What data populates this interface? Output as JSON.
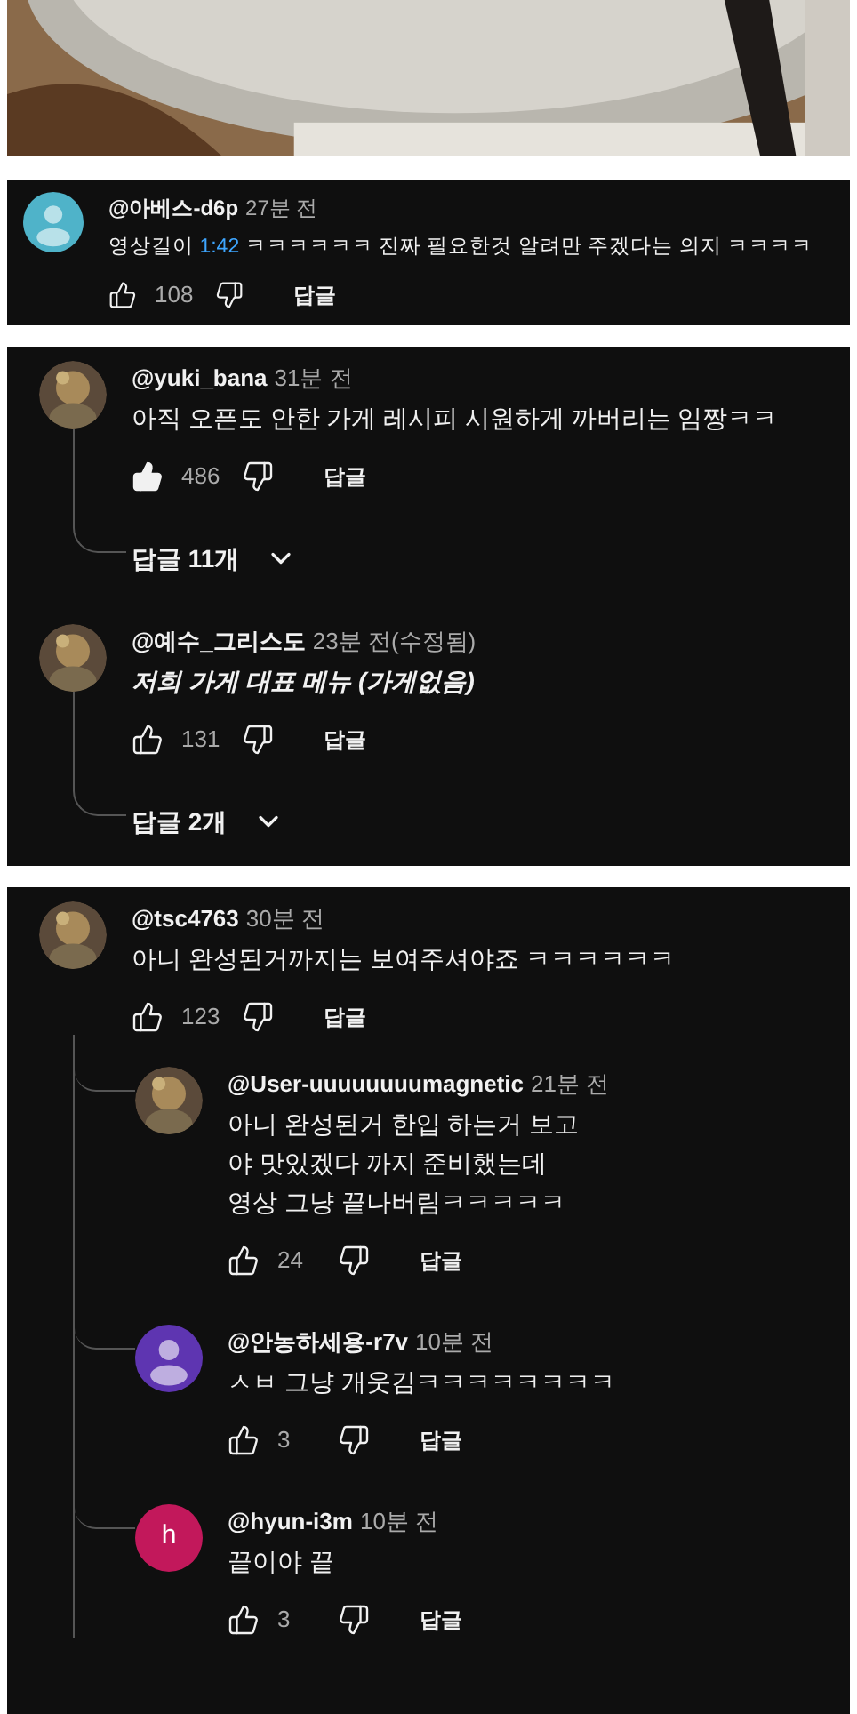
{
  "video_frame": {
    "kind": "picture"
  },
  "panels": [
    {
      "comments": [
        {
          "author": "@아베스-d6p",
          "time": "27분 전",
          "text_parts": [
            {
              "kind": "plain",
              "text": "영상길이 "
            },
            {
              "kind": "link",
              "text": "1:42"
            },
            {
              "kind": "plain",
              "text": " ㅋㅋㅋㅋㅋㅋ 진짜 필요한것 알려만 주겠다는 의지 ㅋㅋㅋㅋ"
            }
          ],
          "italic": false,
          "likes": "108",
          "liked": false,
          "reply_label": "답글",
          "avatar": {
            "kind": "person",
            "color": "#4fb3c9"
          }
        }
      ]
    },
    {
      "comments": [
        {
          "author": "@yuki_bana",
          "time": "31분 전",
          "text_parts": [
            {
              "kind": "plain",
              "text": "아직 오픈도 안한 가게 레시피 시원하게 까버리는 임짱ㅋㅋ"
            }
          ],
          "italic": false,
          "likes": "486",
          "liked": true,
          "reply_label": "답글",
          "replies_toggle": "답글 11개",
          "avatar": {
            "kind": "picture"
          }
        },
        {
          "author": "@예수_그리스도",
          "time": "23분 전(수정됨)",
          "text_parts": [
            {
              "kind": "plain",
              "text": "저희 가게 대표 메뉴 (가게없음)"
            }
          ],
          "italic": true,
          "likes": "131",
          "liked": false,
          "reply_label": "답글",
          "replies_toggle": "답글 2개",
          "avatar": {
            "kind": "picture"
          }
        }
      ]
    },
    {
      "comments": [
        {
          "author": "@tsc4763",
          "time": "30분 전",
          "text_parts": [
            {
              "kind": "plain",
              "text": "아니 완성된거까지는 보여주셔야죠 ㅋㅋㅋㅋㅋㅋ"
            }
          ],
          "italic": false,
          "likes": "123",
          "liked": false,
          "reply_label": "답글",
          "avatar": {
            "kind": "picture"
          },
          "replies": [
            {
              "author": "@User-uuuuuuuumagnetic",
              "time": "21분 전",
              "text_parts": [
                {
                  "kind": "plain",
                  "text": "아니 완성된거 한입 하는거 보고\n야 맛있겠다 까지 준비했는데\n영상 그냥 끝나버림ㅋㅋㅋㅋㅋ"
                }
              ],
              "italic": false,
              "likes": "24",
              "liked": false,
              "reply_label": "답글",
              "avatar": {
                "kind": "picture"
              }
            },
            {
              "author": "@안농하세용-r7v",
              "time": "10분 전",
              "text_parts": [
                {
                  "kind": "plain",
                  "text": "ㅅㅂ 그냥 개웃김ㅋㅋㅋㅋㅋㅋㅋㅋ"
                }
              ],
              "italic": false,
              "likes": "3",
              "liked": false,
              "reply_label": "답글",
              "avatar": {
                "kind": "person",
                "color": "#5e35b1"
              }
            },
            {
              "author": "@hyun-i3m",
              "time": "10분 전",
              "text_parts": [
                {
                  "kind": "plain",
                  "text": "끝이야 끝"
                }
              ],
              "italic": false,
              "likes": "3",
              "liked": false,
              "reply_label": "답글",
              "avatar": {
                "kind": "letter",
                "letter": "h",
                "color": "#c2185b"
              }
            }
          ]
        }
      ]
    }
  ]
}
